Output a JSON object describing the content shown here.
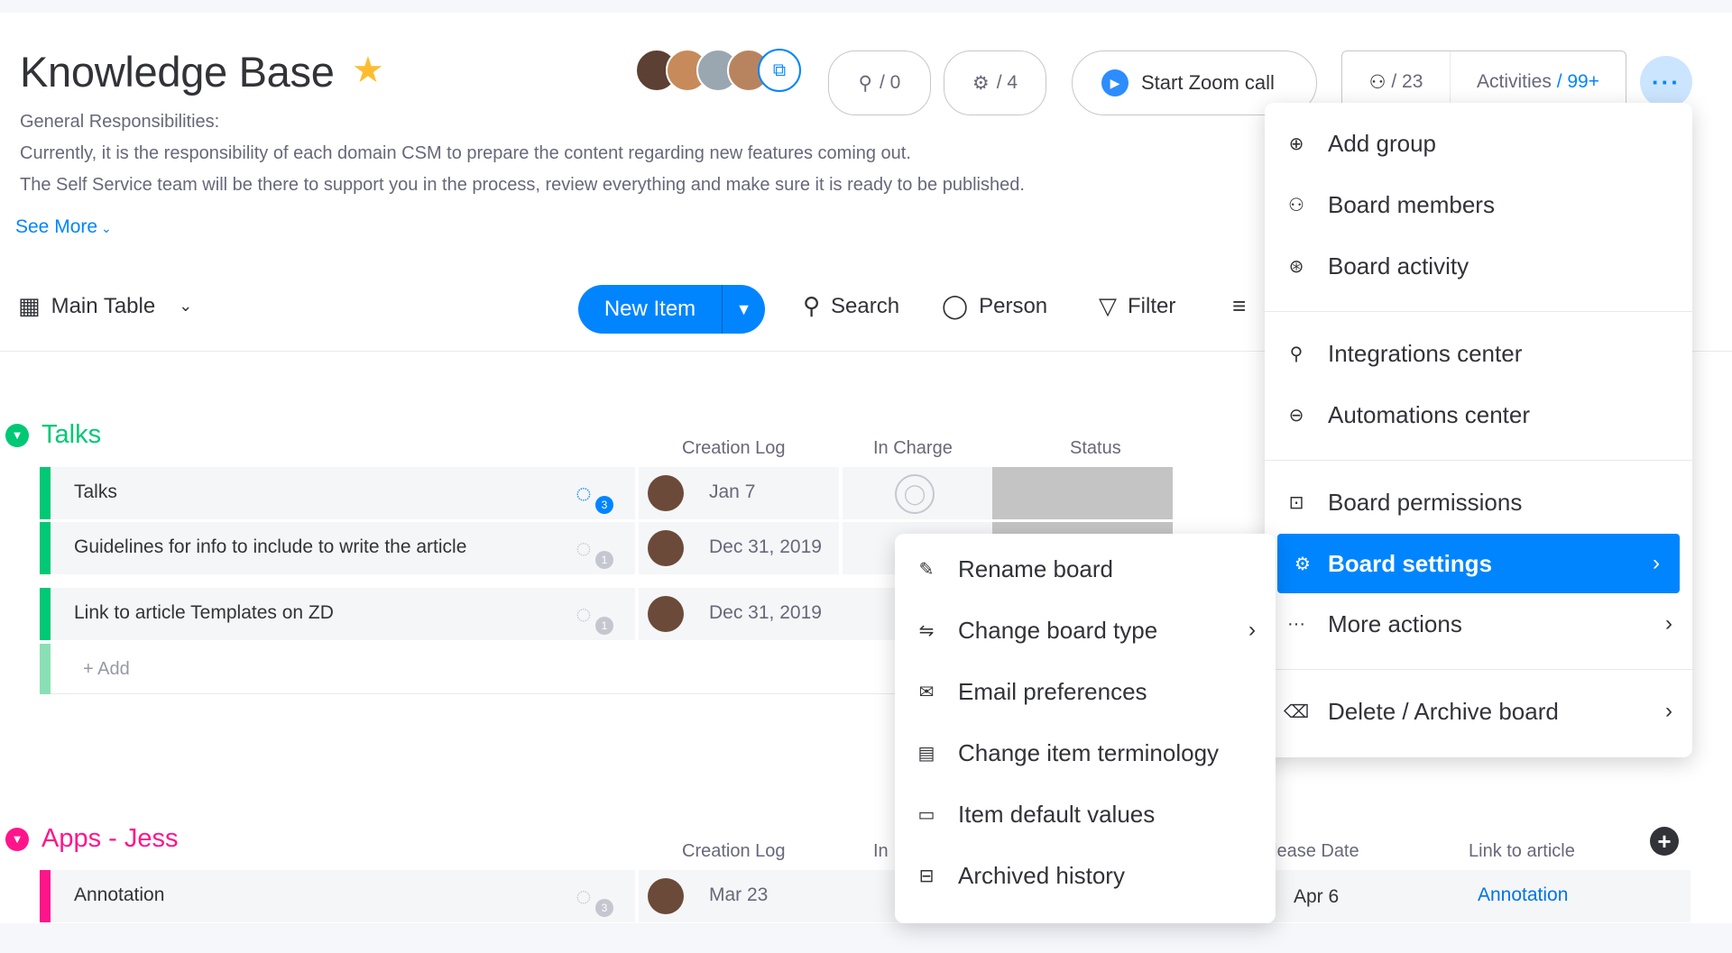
{
  "board": {
    "title": "Knowledge Base",
    "description_lines": [
      "General Responsibilities:",
      "Currently, it is the responsibility of each domain CSM to prepare the content regarding new features coming out.",
      "The Self Service team will be there to support you in the process, review everything and make sure it is ready to be published."
    ],
    "see_more": "See More"
  },
  "header": {
    "integrations_count": "/ 0",
    "automations_count": "/ 4",
    "zoom_label": "Start Zoom call",
    "members_count": "/ 23",
    "activities_label": "Activities",
    "activities_count": "/ 99+",
    "more_icon": "···"
  },
  "toolbar": {
    "view_label": "Main Table",
    "new_item": "New Item",
    "search": "Search",
    "person": "Person",
    "filter": "Filter"
  },
  "groups": [
    {
      "name": "Talks",
      "color": "#00c875",
      "columns": [
        "Creation Log",
        "In Charge",
        "Status"
      ],
      "rows": [
        {
          "name": "Talks",
          "updates": "3",
          "date": "Jan 7"
        },
        {
          "name": "Guidelines for info to include to write the article",
          "updates": "1",
          "date": "Dec 31, 2019"
        },
        {
          "name": "Link to article Templates on ZD",
          "updates": "1",
          "date": "Dec 31, 2019"
        }
      ],
      "add_label": "+ Add"
    },
    {
      "name": "Apps - Jess",
      "color": "#ff158a",
      "columns": [
        "Creation Log",
        "In",
        "lease Date",
        "Link to article"
      ],
      "rows": [
        {
          "name": "Annotation",
          "updates": "3",
          "date": "Mar 23",
          "release_date": "Apr 6",
          "link": "Annotation"
        }
      ]
    }
  ],
  "main_menu": {
    "items": [
      {
        "label": "Add group",
        "icon": "plus-circle-icon"
      },
      {
        "label": "Board members",
        "icon": "people-icon"
      },
      {
        "label": "Board activity",
        "icon": "activity-icon"
      },
      {
        "label": "Integrations center",
        "icon": "plug-icon"
      },
      {
        "label": "Automations center",
        "icon": "robot-icon"
      },
      {
        "label": "Board permissions",
        "icon": "lock-icon"
      },
      {
        "label": "Board settings",
        "icon": "gear-icon"
      },
      {
        "label": "More actions",
        "icon": "dots-icon"
      },
      {
        "label": "Delete / Archive board",
        "icon": "trash-icon"
      }
    ]
  },
  "settings_submenu": {
    "items": [
      {
        "label": "Rename board",
        "icon": "pencil-icon"
      },
      {
        "label": "Change board type",
        "icon": "swap-icon"
      },
      {
        "label": "Email preferences",
        "icon": "mail-icon"
      },
      {
        "label": "Change item terminology",
        "icon": "card-icon"
      },
      {
        "label": "Item default values",
        "icon": "form-icon"
      },
      {
        "label": "Archived history",
        "icon": "archive-icon"
      }
    ]
  },
  "colors": {
    "accent": "#0085ff",
    "talks_group": "#00c875",
    "apps_group": "#ff158a",
    "star": "#fdbd2e"
  }
}
